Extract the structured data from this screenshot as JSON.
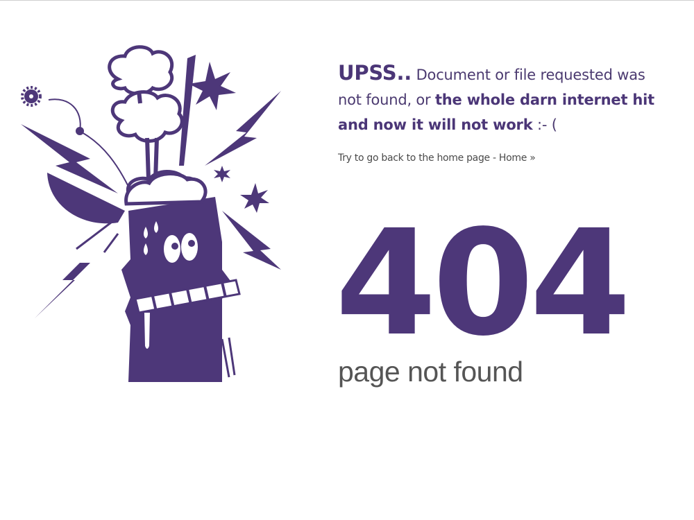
{
  "message": {
    "upss": "UPSS..",
    "part1": " Document or file requested was not found, or ",
    "bold": "the whole darn internet hit and now it will not work",
    "tail": " :- ("
  },
  "back": {
    "text": "Try to go back to the home page - ",
    "link_label": "Home »"
  },
  "error": {
    "code": "404",
    "label": "page not found"
  },
  "illustration": {
    "icon": "exploding-head-icon",
    "color": "#4d3779"
  }
}
